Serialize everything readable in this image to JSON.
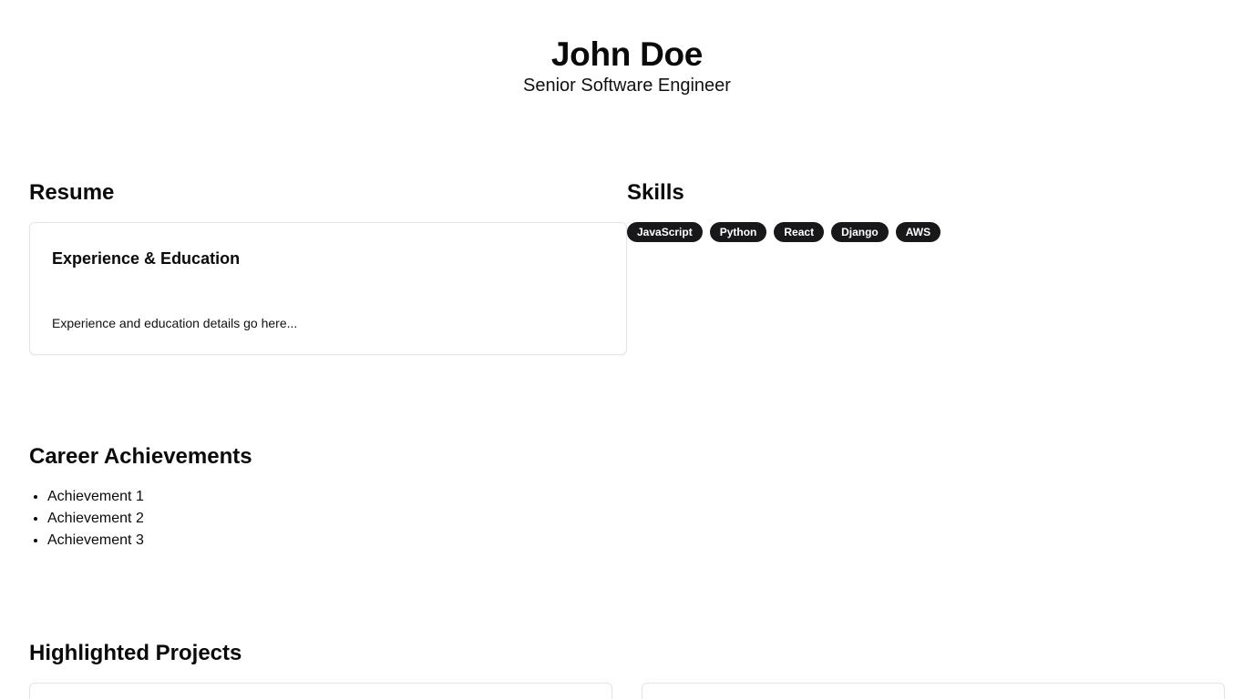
{
  "header": {
    "name": "John Doe",
    "subtitle": "Senior Software Engineer"
  },
  "resume": {
    "title": "Resume",
    "card": {
      "heading": "Experience & Education",
      "body": "Experience and education details go here..."
    }
  },
  "skills": {
    "title": "Skills",
    "items": [
      "JavaScript",
      "Python",
      "React",
      "Django",
      "AWS"
    ]
  },
  "achievements": {
    "title": "Career Achievements",
    "items": [
      "Achievement 1",
      "Achievement 2",
      "Achievement 3"
    ]
  },
  "projects": {
    "title": "Highlighted Projects"
  },
  "colors": {
    "text": "#0a0a0a",
    "badge_bg": "#18181b",
    "badge_text": "#ffffff",
    "card_border": "#e4e4e7"
  }
}
